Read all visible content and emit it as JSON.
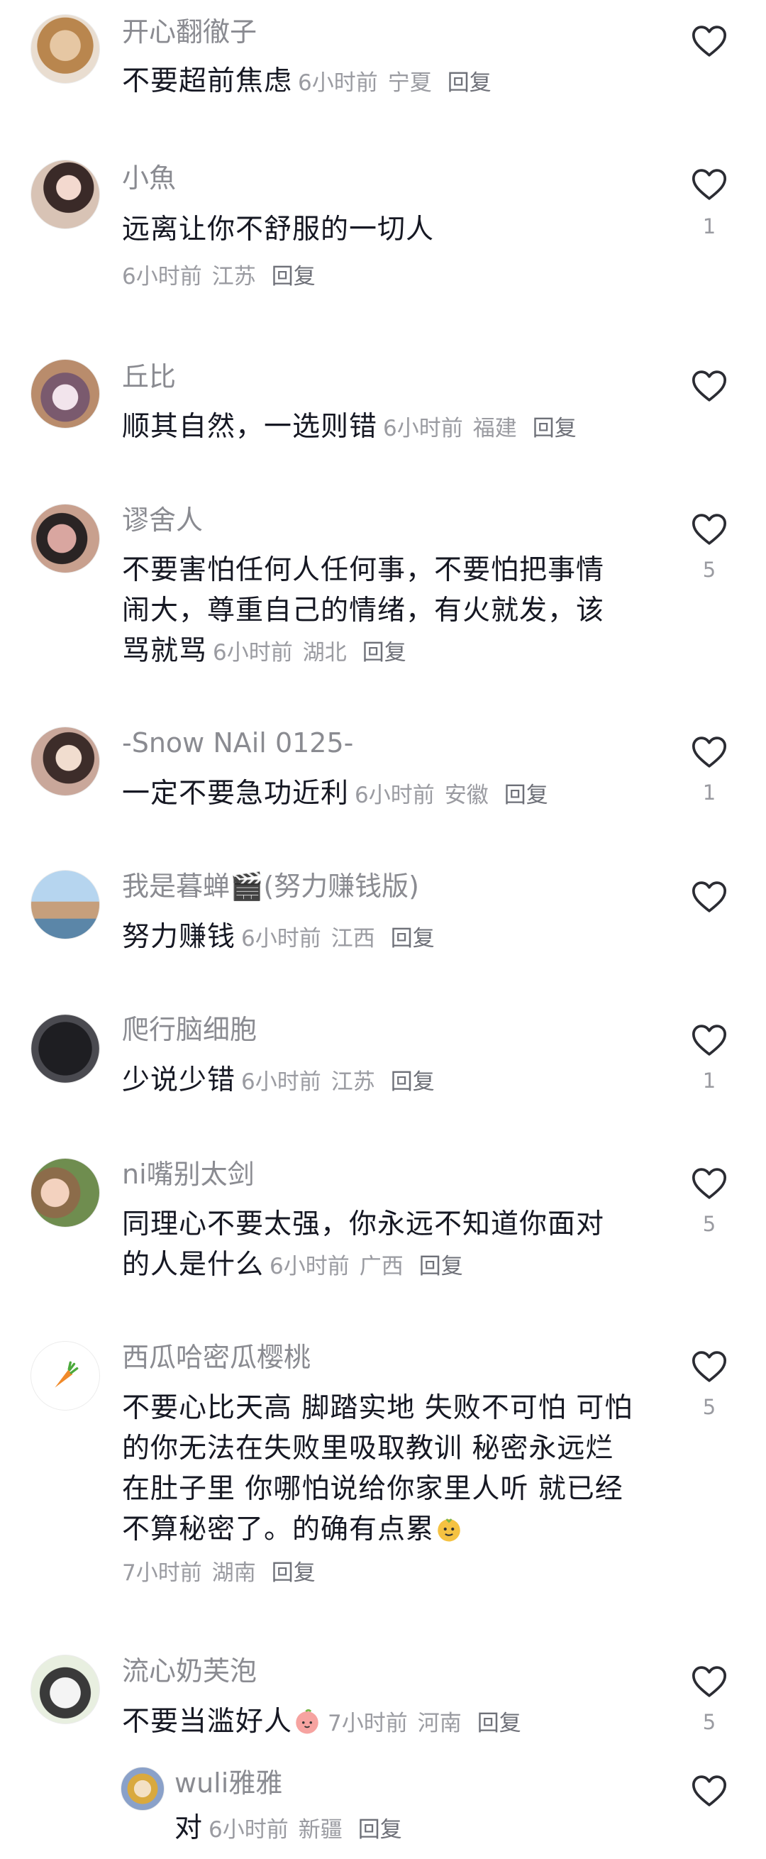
{
  "comments": [
    {
      "name": "开心翻徹子",
      "text": "不要超前焦虑",
      "time": "6小时前",
      "region": "宁夏",
      "reply": "回复",
      "likes": ""
    },
    {
      "name": "小魚",
      "text": "远离让你不舒服的一切人",
      "time": "6小时前",
      "region": "江苏",
      "reply": "回复",
      "likes": "1"
    },
    {
      "name": "丘比",
      "text": "顺其自然，一选则错",
      "time": "6小时前",
      "region": "福建",
      "reply": "回复",
      "likes": ""
    },
    {
      "name": "谬舍人",
      "text_line1": "不要害怕任何人任何事，不要怕把事情",
      "text_line2": "闹大，尊重自己的情绪，有火就发，该",
      "text_line3": "骂就骂",
      "time": "6小时前",
      "region": "湖北",
      "reply": "回复",
      "likes": "5"
    },
    {
      "name": "-Snow NAil 0125-",
      "text": "一定不要急功近利",
      "time": "6小时前",
      "region": "安徽",
      "reply": "回复",
      "likes": "1"
    },
    {
      "name": "我是暮蝉🎬(努力赚钱版)",
      "text": "努力赚钱",
      "time": "6小时前",
      "region": "江西",
      "reply": "回复",
      "likes": ""
    },
    {
      "name": "爬行脑细胞",
      "text": "少说少错",
      "time": "6小时前",
      "region": "江苏",
      "reply": "回复",
      "likes": "1"
    },
    {
      "name": "ni嘴别太剑",
      "text_line1": "同理心不要太强，你永远不知道你面对",
      "text_line2": "的人是什么",
      "time": "6小时前",
      "region": "广西",
      "reply": "回复",
      "likes": "5"
    },
    {
      "name": "西瓜哈密瓜樱桃",
      "text_line1": "不要心比天高 脚踏实地 失败不可怕 可怕",
      "text_line2": "的你无法在失败里吸取教训  秘密永远烂",
      "text_line3": "在肚子里 你哪怕说给你家里人听 就已经",
      "text_line4": "不算秘密了。的确有点累",
      "time": "7小时前",
      "region": "湖南",
      "reply": "回复",
      "likes": "5"
    },
    {
      "name": "流心奶芙泡",
      "text": "不要当滥好人",
      "time": "7小时前",
      "region": "河南",
      "reply": "回复",
      "likes": "5"
    },
    {
      "name": "wuli雅雅",
      "text": "对",
      "time": "6小时前",
      "region": "新疆",
      "reply": "回复",
      "likes": ""
    }
  ],
  "icons": {
    "like": "heart-outline-icon"
  },
  "colors": {
    "text": "#161823",
    "secondary": "#8a8b91",
    "meta": "#9a9ba1"
  }
}
